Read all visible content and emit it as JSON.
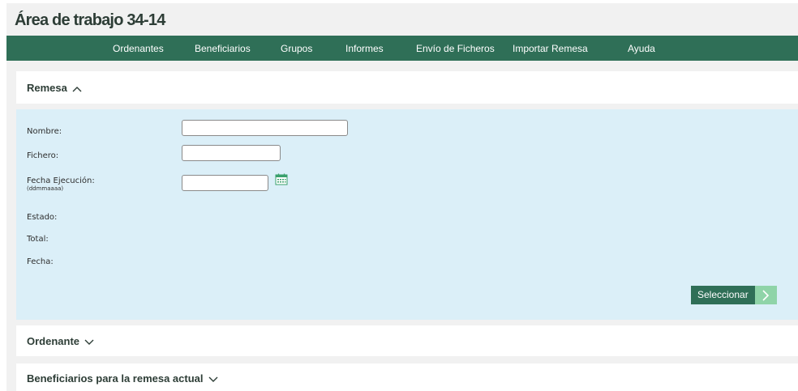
{
  "page": {
    "title": "Área de trabajo 34-14"
  },
  "nav": {
    "items": [
      {
        "label": "Ordenantes"
      },
      {
        "label": "Beneficiarios"
      },
      {
        "label": "Grupos"
      },
      {
        "label": "Informes"
      },
      {
        "label": "Envío de Ficheros"
      },
      {
        "label": "Importar Remesa"
      },
      {
        "label": "Ayuda"
      }
    ]
  },
  "remesa": {
    "title": "Remesa",
    "state": "expanded",
    "fields": {
      "nombre_label": "Nombre:",
      "nombre_value": "",
      "fichero_label": "Fichero:",
      "fichero_value": "",
      "fecha_ejecucion_label": "Fecha Ejecución:",
      "fecha_ejecucion_hint": "(ddmmaaaa)",
      "fecha_ejecucion_value": "",
      "estado_label": "Estado:",
      "total_label": "Total:",
      "fecha_label": "Fecha:"
    },
    "select_button": "Seleccionar"
  },
  "ordenante": {
    "title": "Ordenante",
    "state": "collapsed"
  },
  "beneficiarios": {
    "title": "Beneficiarios para la remesa actual",
    "state": "collapsed"
  },
  "colors": {
    "navbar": "#2f6f57",
    "panel": "#dbeff8",
    "button": "#2f6f57",
    "button_arrow": "#8fd4a8"
  }
}
